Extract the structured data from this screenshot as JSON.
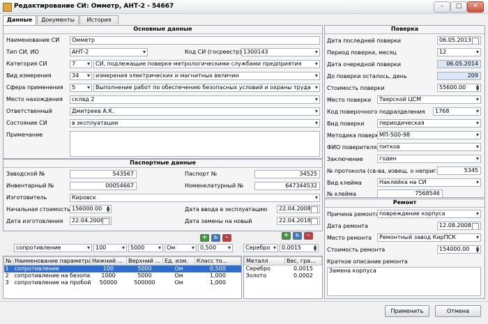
{
  "window": {
    "title": "Редактирование СИ:  Омметр,  АНТ-2 - 54667"
  },
  "tabs": [
    "Данные",
    "Документы",
    "История"
  ],
  "main": {
    "header": "Основные данные",
    "name_label": "Наименование СИ",
    "name_value": "Омметр",
    "type_label": "Тип СИ, ИО",
    "type_value": "АНТ-2",
    "code_label": "Код СИ (госреестр)",
    "code_value": "1300143",
    "category_label": "Категория СИ",
    "category_num": "7",
    "category_text": "СИ, подлежащие поверке метрологическими службами предприятия",
    "measure_label": "Вид измерения",
    "measure_num": "34",
    "measure_text": "измерения электрических и магнитных величин",
    "scope_label": "Сфера применения",
    "scope_num": "5",
    "scope_text": "Выполнение работ по обеспечению безопасных условий и охраны труда",
    "location_label": "Место нахождения",
    "location_value": "склад 2",
    "responsible_label": "Ответственный",
    "responsible_value": "Дмитреев А.К.",
    "state_label": "Состояние СИ",
    "state_value": "в эксплуатации",
    "note_label": "Примечание"
  },
  "passport": {
    "header": "Паспортные данные",
    "serial_label": "Заводской №",
    "serial_value": "543567",
    "pass_label": "Паспорт №",
    "pass_value": "34525",
    "inv_label": "Инвентарный №",
    "inv_value": "00054667",
    "nomen_label": "Номенклатурный №",
    "nomen_value": "647344532",
    "maker_label": "Изготовитель",
    "maker_value": "Кировск",
    "cost_label": "Начальная стоимость",
    "cost_value": "156000.00",
    "commission_label": "Дата ввода в эксплуатацию",
    "commission_value": "22.04.2008",
    "made_label": "Дата изготовления",
    "made_value": "22.04.2008",
    "replace_label": "Дата замены на новый",
    "replace_value": "22.04.2018"
  },
  "params": {
    "filter": {
      "name": "сопротивление",
      "low": "100",
      "high": "5000",
      "unit": "Ом",
      "class": "0,500"
    },
    "columns": [
      "№",
      "Наименование параметра",
      "Нижний ...",
      "Верхний ...",
      "Ед. изм.",
      "Класс то..."
    ],
    "rows": [
      [
        "1",
        "сопротивление",
        "100",
        "5000",
        "Ом",
        "0,500"
      ],
      [
        "2",
        "сопротивление на безопа...",
        "1000",
        "5000",
        "Ом",
        "1,000"
      ],
      [
        "3",
        "сопротивление на пробой",
        "50000",
        "500000",
        "Ом",
        "1,000"
      ]
    ]
  },
  "metals": {
    "filter": {
      "metal": "Серебро",
      "weight": "0.0015"
    },
    "columns": [
      "Металл",
      "Вес, гра..."
    ],
    "rows": [
      [
        "Серебро",
        "0.0015"
      ],
      [
        "Золото",
        "0.0002"
      ]
    ]
  },
  "verification": {
    "header": "Поверка",
    "last_label": "Дата последней поверки",
    "last_value": "06.05.2013",
    "period_label": "Период поверки, месяц",
    "period_value": "12",
    "next_label": "Дата очередной поверки",
    "next_value": "06.05.2014",
    "left_label": "До поверки осталось, день",
    "left_value": "209",
    "cost_label": "Стоимость поверки",
    "cost_value": "55600.00",
    "place_label": "Место поверки",
    "place_value": "Тверской ЦСМ",
    "unit_label": "Код поверочного подразделения",
    "unit_value": "1768",
    "kind_label": "Вид поверки",
    "kind_value": "периодическая",
    "method_label": "Методика поверки",
    "method_value": "МП-500-98",
    "verifier_label": "ФИО поверителя",
    "verifier_value": "питков",
    "conclusion_label": "Заключение",
    "conclusion_value": "годен",
    "protocol_label": "№ протокола (св-ва, извещ. о неприг.)",
    "protocol_value": "5345",
    "stamp_kind_label": "Вид клейма",
    "stamp_kind_value": "Наклейка на СИ",
    "stamp_no_label": "№ клейма",
    "stamp_no_value": "7568546"
  },
  "repair": {
    "header": "Ремонт",
    "reason_label": "Причина ремонта",
    "reason_value": "повреждение корпуса",
    "date_label": "Дата ремонта",
    "date_value": "12.08.2008",
    "place_label": "Место ремонта",
    "place_value": "Ремонтный завод КирПСК",
    "cost_label": "Стоимость ремонта",
    "cost_value": "154000.00",
    "desc_label": "Краткое описание ремонта",
    "desc_value": "Замена корпуса"
  },
  "footer": {
    "apply": "Применить",
    "cancel": "Отмена"
  }
}
